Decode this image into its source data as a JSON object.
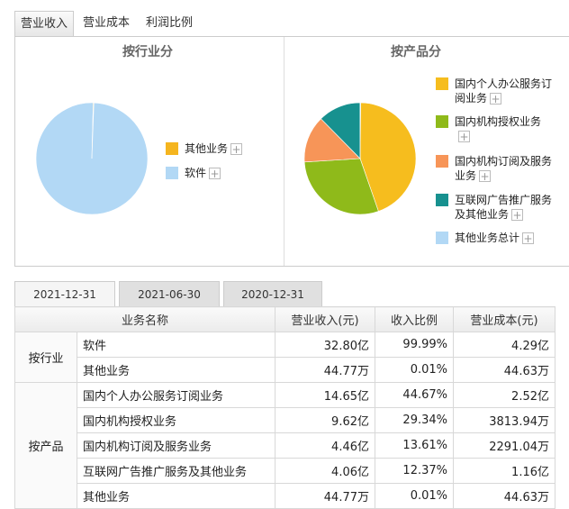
{
  "tabs": [
    "营业收入",
    "营业成本",
    "利润比例"
  ],
  "left_chart": {
    "title": "按行业分",
    "legend": [
      {
        "label": "其他业务",
        "color": "#f5b51f"
      },
      {
        "label": "软件",
        "color": "#b2d8f5"
      }
    ]
  },
  "right_chart": {
    "title": "按产品分",
    "legend": [
      {
        "line1": "国内个人办公服务订",
        "line2": "阅业务",
        "color": "#f6bd1e"
      },
      {
        "line1": "国内机构授权业务",
        "line2": "",
        "color": "#8fba1a"
      },
      {
        "line1": "国内机构订阅及服务",
        "line2": "业务",
        "color": "#f79558"
      },
      {
        "line1": "互联网广告推广服务",
        "line2": "及其他业务",
        "color": "#17918f"
      },
      {
        "line1": "其他业务总计",
        "line2": "",
        "color": "#b2d8f5"
      }
    ]
  },
  "chart_data": [
    {
      "type": "pie",
      "title": "按行业分",
      "categories": [
        "软件",
        "其他业务"
      ],
      "values": [
        99.99,
        0.01
      ]
    },
    {
      "type": "pie",
      "title": "按产品分",
      "categories": [
        "国内个人办公服务订阅业务",
        "国内机构授权业务",
        "国内机构订阅及服务业务",
        "互联网广告推广服务及其他业务",
        "其他业务总计"
      ],
      "values": [
        44.67,
        29.34,
        13.61,
        12.37,
        0.01
      ]
    }
  ],
  "date_tabs": [
    "2021-12-31",
    "2021-06-30",
    "2020-12-31"
  ],
  "table": {
    "headers": [
      "业务名称",
      "营业收入(元)",
      "收入比例",
      "营业成本(元)"
    ],
    "groups": [
      {
        "name": "按行业",
        "rows": [
          {
            "name": "软件",
            "revenue": "32.80亿",
            "ratio": "99.99%",
            "cost": "4.29亿"
          },
          {
            "name": "其他业务",
            "revenue": "44.77万",
            "ratio": "0.01%",
            "cost": "44.63万"
          }
        ]
      },
      {
        "name": "按产品",
        "rows": [
          {
            "name": "国内个人办公服务订阅业务",
            "revenue": "14.65亿",
            "ratio": "44.67%",
            "cost": "2.52亿"
          },
          {
            "name": "国内机构授权业务",
            "revenue": "9.62亿",
            "ratio": "29.34%",
            "cost": "3813.94万"
          },
          {
            "name": "国内机构订阅及服务业务",
            "revenue": "4.46亿",
            "ratio": "13.61%",
            "cost": "2291.04万"
          },
          {
            "name": "互联网广告推广服务及其他业务",
            "revenue": "4.06亿",
            "ratio": "12.37%",
            "cost": "1.16亿"
          },
          {
            "name": "其他业务",
            "revenue": "44.77万",
            "ratio": "0.01%",
            "cost": "44.63万"
          }
        ]
      }
    ]
  }
}
